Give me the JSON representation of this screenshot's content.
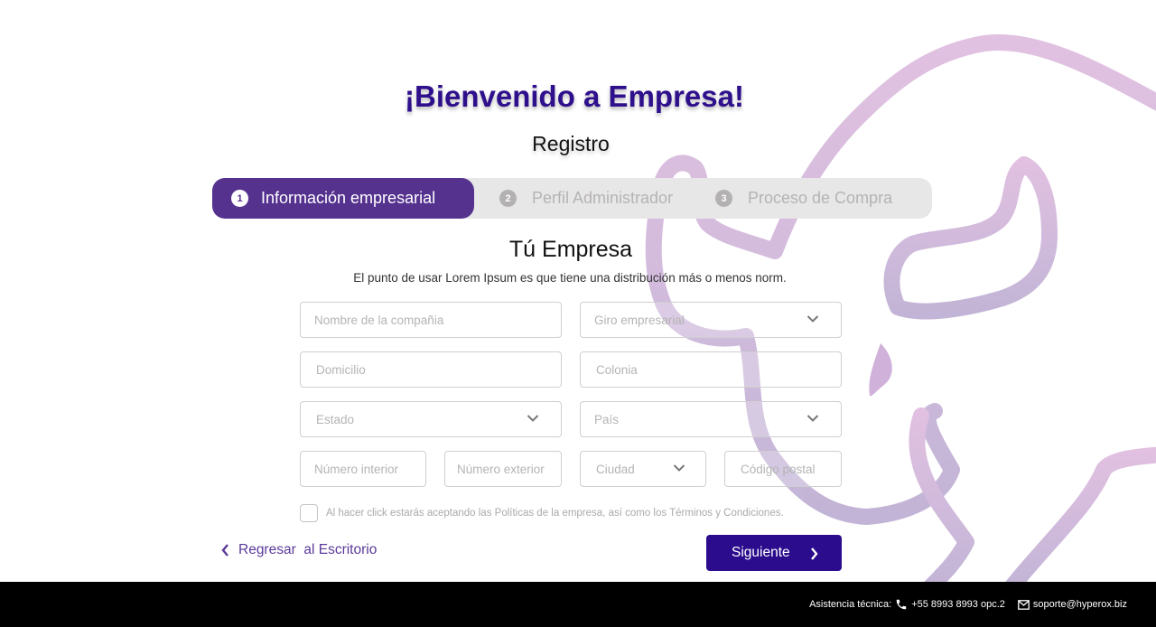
{
  "header": {
    "welcome": "¡Bienvenido a Empresa!",
    "subtitle": "Registro"
  },
  "stepper": {
    "steps": [
      {
        "number": "1",
        "label": "Información empresarial",
        "active": true
      },
      {
        "number": "2",
        "label": "Perfil Administrador",
        "active": false
      },
      {
        "number": "3",
        "label": "Proceso de Compra",
        "active": false
      }
    ]
  },
  "section": {
    "title": "Tú Empresa",
    "description": "El punto de usar Lorem Ipsum es que tiene una distribución más o menos norm."
  },
  "form": {
    "company_name": "Nombre de la compañia",
    "business_type": "Giro empresarial",
    "address": "Domicilio",
    "neighborhood": "Colonia",
    "state": "Estado",
    "country": "País",
    "interior_number": "Número interior",
    "exterior_number": "Número exterior",
    "city": "Ciudad",
    "postal_code": "Código postal",
    "terms_text": "Al hacer click estarás aceptando las Políticas de la empresa, así como los Términos y Condiciones.",
    "terms_checked": false
  },
  "actions": {
    "back_label": "Regresar  al Escritorio",
    "next_label": "Siguiente"
  },
  "footer": {
    "support_label": "Asistencia técnica:",
    "phone": "+55 8993 8993 opc.2",
    "email": "soporte@hyperox.biz"
  },
  "colors": {
    "primary": "#2b0c8c",
    "step_active": "#56328f",
    "stepper_bg": "#e8e7e7",
    "footer_bg": "#000000"
  },
  "icons": [
    "chevron-down-icon",
    "chevron-left-icon",
    "chevron-right-icon",
    "phone-icon",
    "mail-icon"
  ]
}
